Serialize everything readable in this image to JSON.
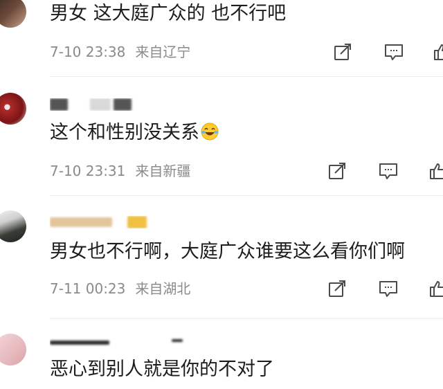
{
  "comments": [
    {
      "text": "男女 这大庭广众的 也不行吧",
      "time": "7-10 23:38",
      "location": "来自辽宁"
    },
    {
      "text": "这个和性别没关系",
      "time": "7-10 23:31",
      "location": "来自新疆"
    },
    {
      "text": "男女也不行啊，大庭广众谁要这么看你们啊",
      "time": "7-11 00:23",
      "location": "来自湖北"
    },
    {
      "text": "恶心到别人就是你的不对了"
    }
  ],
  "icons": {
    "share": "share-icon",
    "reply": "comment-icon",
    "like": "thumbs-up-icon",
    "emoji": "laughing-tears-emoji"
  },
  "colors": {
    "meta": "#8a8a8a",
    "icon": "#4a4a4a",
    "divider": "#ececec"
  }
}
